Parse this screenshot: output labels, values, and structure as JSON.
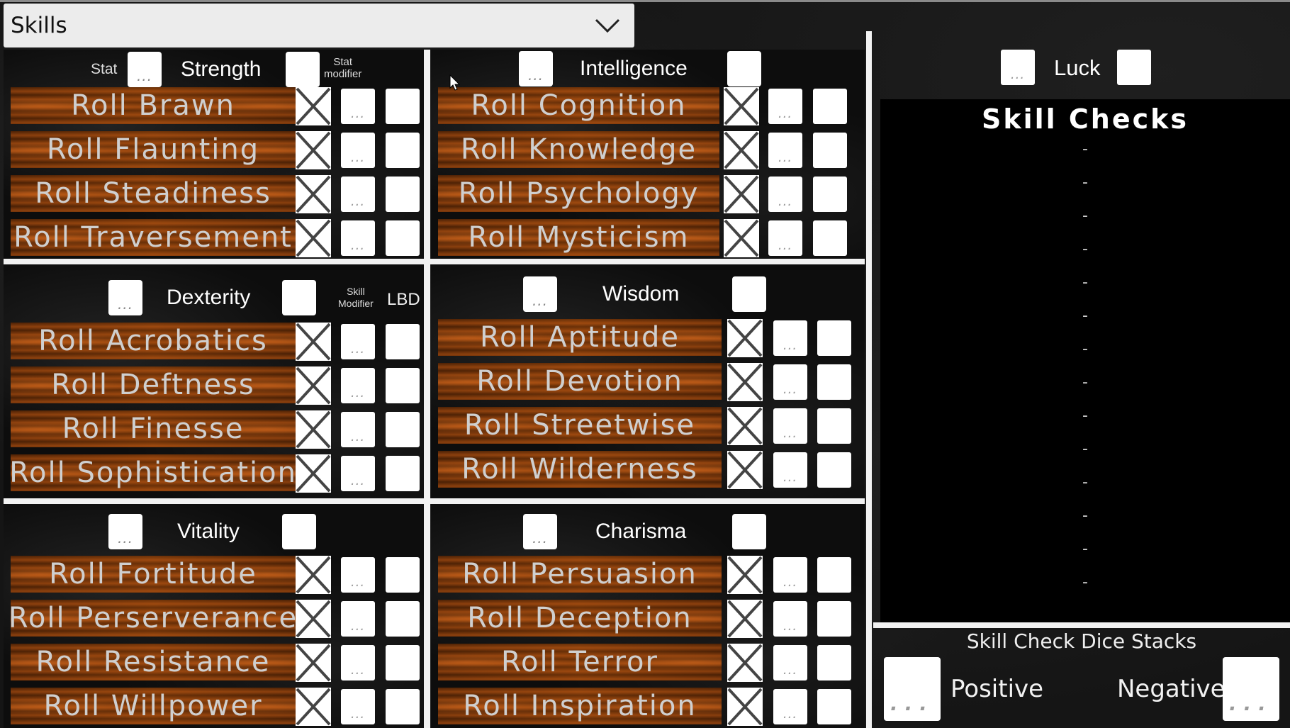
{
  "dropdown": {
    "selected": "Skills"
  },
  "placeholder_glyph": "...",
  "headers": {
    "stat_label": "Stat",
    "stat_modifier_label_1": "Stat",
    "stat_modifier_label_2": "modifier",
    "skill_modifier_label_1": "Skill",
    "skill_modifier_label_2": "Modifier",
    "lbd_label": "LBD"
  },
  "stats": [
    {
      "name": "Strength",
      "skills": [
        "Roll Brawn",
        "Roll Flaunting",
        "Roll Steadiness",
        "Roll Traversement"
      ]
    },
    {
      "name": "Intelligence",
      "skills": [
        "Roll Cognition",
        "Roll Knowledge",
        "Roll Psychology",
        "Roll Mysticism"
      ]
    },
    {
      "name": "Dexterity",
      "skills": [
        "Roll Acrobatics",
        "Roll Deftness",
        "Roll Finesse",
        "Roll Sophistication"
      ]
    },
    {
      "name": "Wisdom",
      "skills": [
        "Roll Aptitude",
        "Roll Devotion",
        "Roll Streetwise",
        "Roll Wilderness"
      ]
    },
    {
      "name": "Vitality",
      "skills": [
        "Roll Fortitude",
        "Roll Perserverance",
        "Roll Resistance",
        "Roll Willpower"
      ]
    },
    {
      "name": "Charisma",
      "skills": [
        "Roll Persuasion",
        "Roll Deception",
        "Roll Terror",
        "Roll Inspiration"
      ]
    }
  ],
  "luck": {
    "name": "Luck"
  },
  "skill_checks": {
    "title": "Skill Checks",
    "entries": [
      "-",
      "-",
      "-",
      "-",
      "-",
      "-",
      "-",
      "-",
      "-",
      "-",
      "-",
      "-",
      "-",
      "-"
    ]
  },
  "dice_stacks": {
    "title": "Skill Check Dice Stacks",
    "positive_label": "Positive",
    "negative_label": "Negative"
  }
}
